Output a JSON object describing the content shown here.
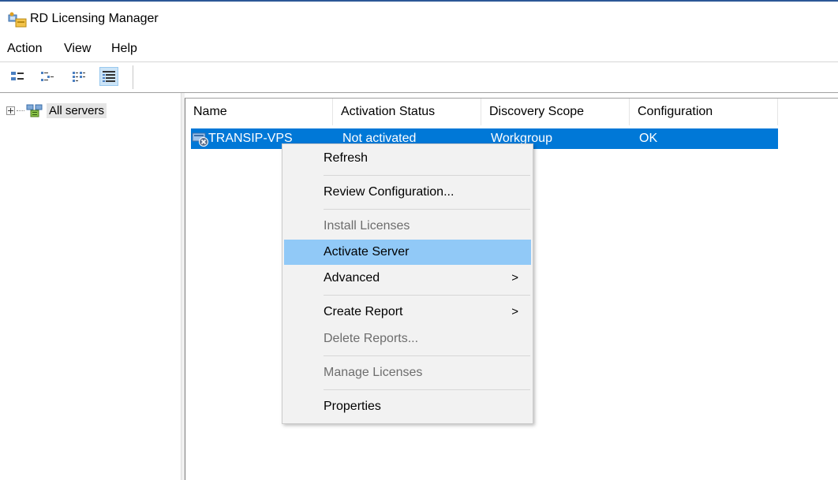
{
  "window": {
    "title": "RD Licensing Manager"
  },
  "menubar": {
    "items": [
      "Action",
      "View",
      "Help"
    ]
  },
  "toolbar": {
    "buttons": [
      "large-icons-icon",
      "small-icons-icon",
      "list-icon",
      "details-icon"
    ],
    "active_index": 3
  },
  "tree": {
    "root_label": "All servers"
  },
  "table": {
    "columns": [
      "Name",
      "Activation Status",
      "Discovery Scope",
      "Configuration"
    ],
    "rows": [
      {
        "name": "TRANSIP-VPS",
        "activation_status": "Not activated",
        "discovery_scope": "Workgroup",
        "configuration": "OK"
      }
    ]
  },
  "context_menu": {
    "items": [
      {
        "label": "Refresh",
        "enabled": true
      },
      {
        "label": "Review Configuration...",
        "enabled": true
      },
      {
        "label": "Install Licenses",
        "enabled": false
      },
      {
        "label": "Activate Server",
        "enabled": true,
        "highlighted": true
      },
      {
        "label": "Advanced",
        "enabled": true,
        "submenu_arrow": ">"
      },
      {
        "label": "Create Report",
        "enabled": true,
        "submenu_arrow": ">"
      },
      {
        "label": "Delete Reports...",
        "enabled": false
      },
      {
        "label": "Manage Licenses",
        "enabled": false
      },
      {
        "label": "Properties",
        "enabled": true
      }
    ]
  },
  "colors": {
    "selection": "#0078d7",
    "menu_hover": "#91c9f7",
    "menu_bg": "#f2f2f2"
  }
}
